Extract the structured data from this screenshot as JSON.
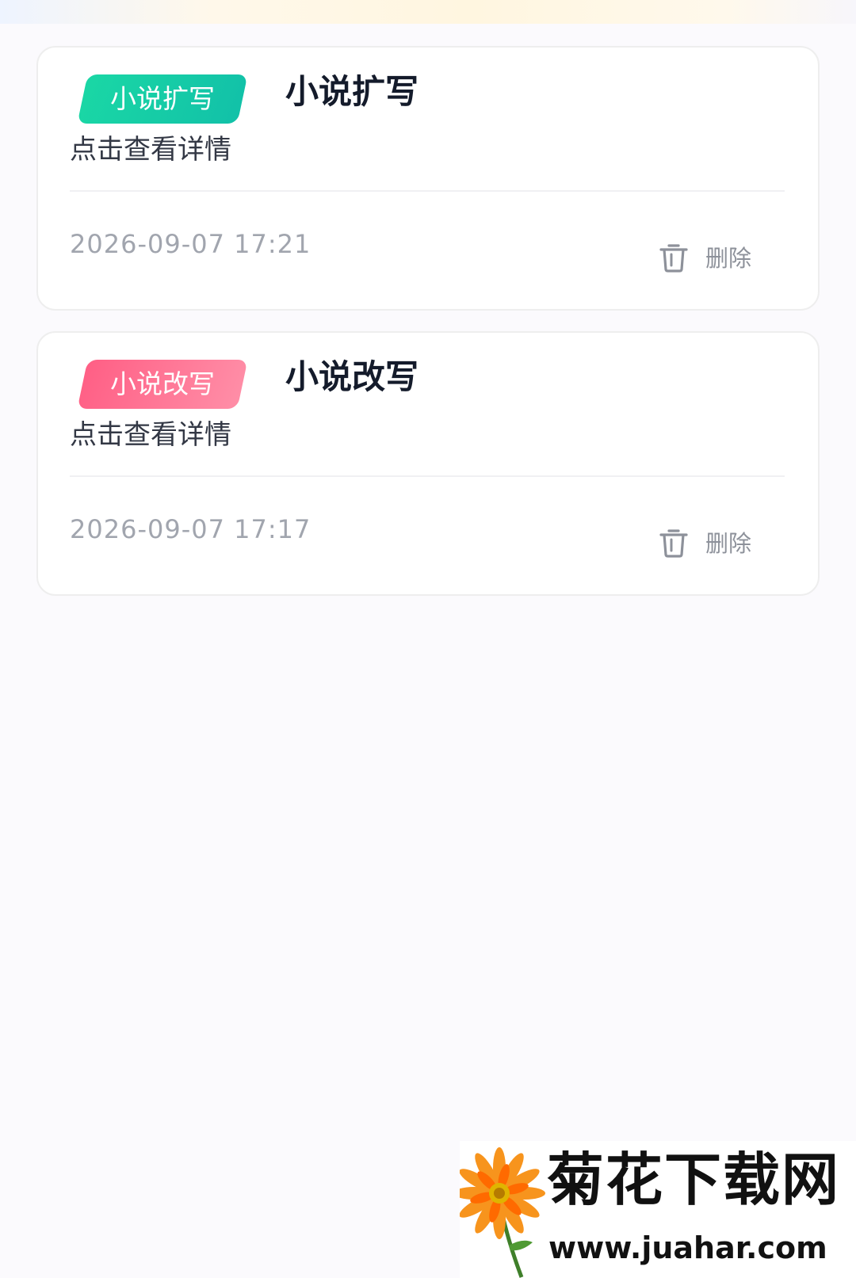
{
  "cards": [
    {
      "tag": "小说扩写",
      "tag_color": "#14c9a6",
      "title": "小说扩写",
      "subtitle": "点击查看详情",
      "timestamp": "2026-09-07 17:21",
      "delete_label": "删除"
    },
    {
      "tag": "小说改写",
      "tag_color": "#ff6f90",
      "title": "小说改写",
      "subtitle": "点击查看详情",
      "timestamp": "2026-09-07 17:17",
      "delete_label": "删除"
    }
  ],
  "watermark": {
    "title": "菊花下载网",
    "url": "www.juahar.com",
    "icon": "chrysanthemum-icon"
  },
  "icons": {
    "delete": "trash-icon"
  }
}
